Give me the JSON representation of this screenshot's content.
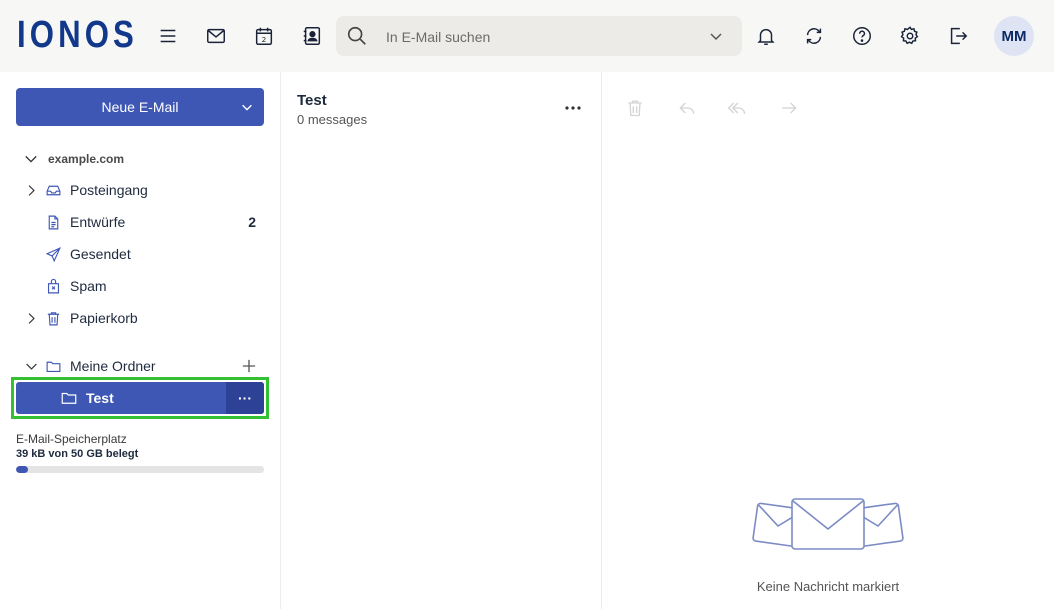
{
  "header": {
    "logo": "IONOS",
    "search_placeholder": "In E-Mail suchen",
    "avatar_initials": "MM",
    "icons": [
      "menu-icon",
      "mail-icon",
      "calendar-icon",
      "contacts-icon",
      "search-icon",
      "chevron-down-icon",
      "bell-icon",
      "refresh-icon",
      "help-icon",
      "gear-icon",
      "logout-icon"
    ],
    "calendar_day": "2"
  },
  "sidebar": {
    "compose_label": "Neue E-Mail",
    "account": "example.com",
    "folders": [
      {
        "label": "Posteingang",
        "icon": "inbox-icon",
        "expandable": true
      },
      {
        "label": "Entwürfe",
        "icon": "drafts-icon",
        "count": "2"
      },
      {
        "label": "Gesendet",
        "icon": "sent-icon"
      },
      {
        "label": "Spam",
        "icon": "spam-icon"
      },
      {
        "label": "Papierkorb",
        "icon": "trash-icon",
        "expandable": true
      }
    ],
    "my_folders_label": "Meine Ordner",
    "selected_folder": {
      "label": "Test",
      "more": "···"
    },
    "storage": {
      "title": "E-Mail-Speicherplatz",
      "used": "39 kB von 50 GB belegt",
      "fill_fraction": 0.05
    }
  },
  "list": {
    "title": "Test",
    "subtitle": "0 messages"
  },
  "reader": {
    "tools": [
      "delete-icon",
      "reply-icon",
      "reply-all-icon",
      "forward-icon"
    ],
    "empty_text": "Keine Nachricht markiert"
  },
  "colors": {
    "brand": "#11388a",
    "accent": "#3e57b5",
    "highlight_frame": "#34c033"
  }
}
